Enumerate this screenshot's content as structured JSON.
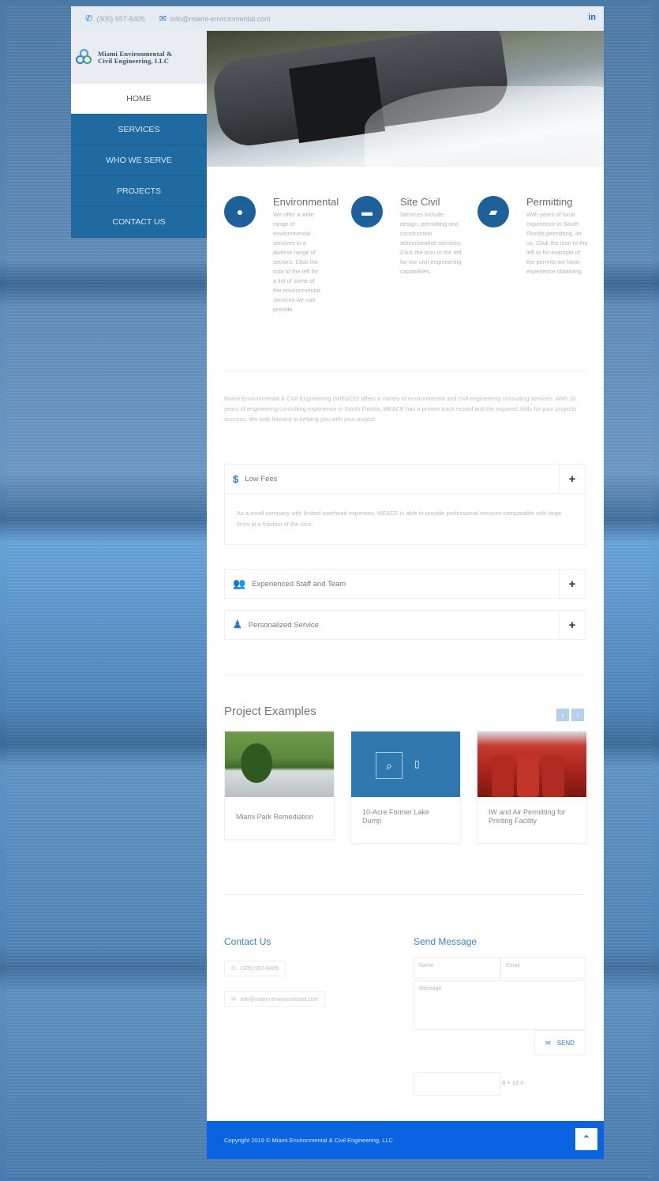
{
  "topbar": {
    "phone": "(305) 557-8405",
    "email": "info@miami-environmental.com",
    "social": "in"
  },
  "logo": {
    "line1": "Miami Environmental &",
    "line2": "Civil Engineering, LLC"
  },
  "nav": {
    "items": [
      "HOME",
      "SERVICES",
      "WHO WE SERVE",
      "PROJECTS",
      "CONTACT US"
    ]
  },
  "features": [
    {
      "title": "Environmental",
      "icon": "globe-icon",
      "text": "We offer a wide range of environmental services in a diverse range of sectors. Click the icon to the left for a list of some of the environmental services we can provide."
    },
    {
      "title": "Site Civil",
      "icon": "briefcase-icon",
      "text": "Services include design, permitting and construction administrative services. Click the icon to the left for our civil engineering capabilities."
    },
    {
      "title": "Permitting",
      "icon": "document-icon",
      "text": "With years of local experience in South Florida permitting, let us. Click the icon to the left to for example of the permits we have experience obtaining."
    }
  ],
  "intro": "Miami Environmental & Civil Engineering (MIE&CE) offers a variety of environmental and civil engineering consulting services. With 10 years of engineering consulting experience in South Florida, ME&CE has a proven track record and the required skills for your projects success. We look forward to helping you with your project.",
  "accordion": [
    {
      "title": "Low Fees",
      "icon": "dollar-icon",
      "body": "As a small company with limited overhead expenses, ME&CE is able to provide professional services comparable with large firms at a fraction of the cost."
    },
    {
      "title": "Experienced Staff and Team",
      "icon": "users-icon",
      "body": ""
    },
    {
      "title": "Personalized Service",
      "icon": "person-icon",
      "body": ""
    }
  ],
  "projects": {
    "title": "Project Examples",
    "items": [
      {
        "caption": "Miami Park Remediation"
      },
      {
        "caption": "10-Acre Former Lake Dump"
      },
      {
        "caption": "IW and Air Permitting for Printing Facility"
      }
    ]
  },
  "contact": {
    "title": "Contact Us",
    "phone": "(305) 557-8405",
    "email": "info@miami-environmental.com"
  },
  "message": {
    "title": "Send Message",
    "name_placeholder": "Name",
    "email_placeholder": "Email",
    "message_placeholder": "Message",
    "send_label": "SEND",
    "captcha": "8 + 13 ="
  },
  "footer": {
    "copyright": "Copyright 2019 © Miami Environmental & Civil Engineering, LLC"
  },
  "colors": {
    "accent": "#1e6aa1",
    "footer": "#0a63e0",
    "link": "#3b86c8"
  }
}
